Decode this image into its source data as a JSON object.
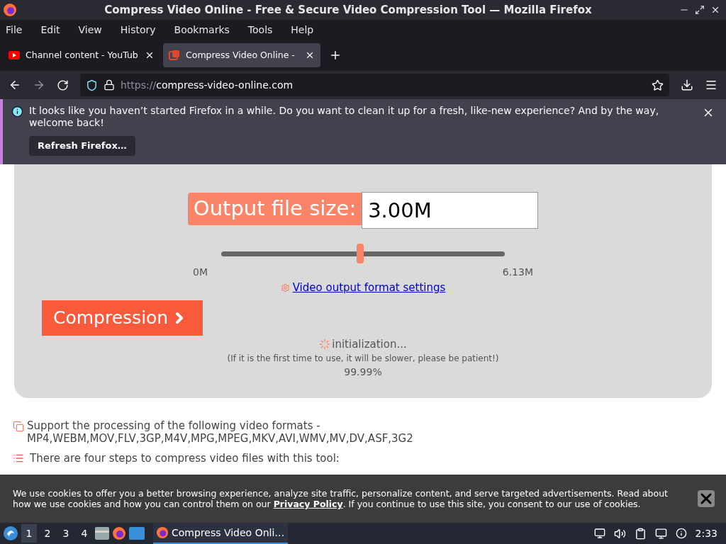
{
  "window": {
    "title": "Compress Video Online - Free & Secure Video Compression Tool — Mozilla Firefox"
  },
  "menu": [
    "File",
    "Edit",
    "View",
    "History",
    "Bookmarks",
    "Tools",
    "Help"
  ],
  "tabs": [
    {
      "label": "Channel content - YouTub",
      "selected": false,
      "kind": "video"
    },
    {
      "label": "Compress Video Online -",
      "selected": true,
      "kind": "compress"
    }
  ],
  "address": {
    "prefix": "https://",
    "host": "compress-video-online.com"
  },
  "notification": {
    "message": "It looks like you haven’t started Firefox in a while. Do you want to clean it up for a fresh, like-new experience? And by the way, welcome back!",
    "button": "Refresh Firefox…"
  },
  "compressor": {
    "size_label": "Output file size:",
    "size_value": "3.00M",
    "slider": {
      "level": 0.49,
      "min": "0M",
      "max": "6.13M"
    },
    "settings_link": "Video output format settings",
    "button": "Compression",
    "status": "initialization...",
    "note": "(If it is the first time to use, it will be slower, please be patient!)",
    "progress": "99.99%"
  },
  "info": {
    "formats": "Support the processing of the following video formats - MP4,WEBM,MOV,FLV,3GP,M4V,MPG,MPEG,MKV,AVI,WMV,MV,DV,ASF,3G2",
    "steps_heading": "There are four steps to compress video files with this tool:"
  },
  "cookie_banner": {
    "before": "We use cookies to offer you a better browsing experience, analyze site traffic, personalize content, and serve targeted advertisements. Read about how we use cookies and how you can control them on our",
    "link": "Privacy Policy",
    "after": ". If you continue to use this site, you consent to our use of cookies."
  },
  "taskbar": {
    "workspaces": [
      {
        "label": "1",
        "selected": true
      },
      {
        "label": "2",
        "selected": false
      },
      {
        "label": "3",
        "selected": false
      },
      {
        "label": "4",
        "selected": false
      }
    ],
    "task": "Compress Video Onli…",
    "clock": "2:33"
  }
}
